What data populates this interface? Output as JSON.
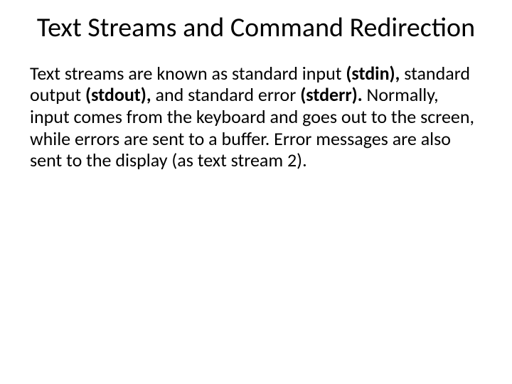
{
  "title": "Text Streams and Command Redirection",
  "body": {
    "t1": "Text streams are known as standard input ",
    "b1": "(stdin),",
    "t2": " standard output ",
    "b2": "(stdout),",
    "t3": " and standard error ",
    "b3": "(stderr).",
    "t4": " Normally, input comes from the keyboard and goes out to the screen, while errors are sent to a buffer. Error messages are also sent to the display (as text stream 2)."
  }
}
